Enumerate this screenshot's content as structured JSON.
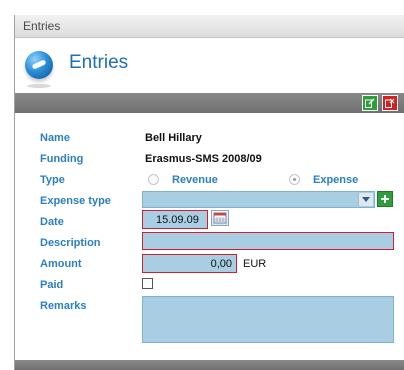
{
  "window": {
    "title": "Entries"
  },
  "header": {
    "title": "Entries",
    "icon": "app-logo-icon"
  },
  "toolbar": {
    "buttons": [
      {
        "icon": "edit-icon",
        "color": "#2e9e3a"
      },
      {
        "icon": "close-icon",
        "color": "#d42020"
      }
    ]
  },
  "form": {
    "name": {
      "label": "Name",
      "value": "Bell Hillary"
    },
    "funding": {
      "label": "Funding",
      "value": "Erasmus-SMS 2008/09"
    },
    "type": {
      "label": "Type",
      "options": [
        "Revenue",
        "Expense"
      ],
      "selected": "Expense"
    },
    "expense_type": {
      "label": "Expense type",
      "value": ""
    },
    "date": {
      "label": "Date",
      "value": "15.09.09"
    },
    "description": {
      "label": "Description",
      "value": ""
    },
    "amount": {
      "label": "Amount",
      "value": "0,00",
      "unit": "EUR"
    },
    "paid": {
      "label": "Paid",
      "checked": false
    },
    "remarks": {
      "label": "Remarks",
      "value": ""
    }
  },
  "colors": {
    "label": "#2b7fc2",
    "field": "#a9cde3",
    "required_border": "#d0202a",
    "toolbar": "#7a7a7a"
  }
}
